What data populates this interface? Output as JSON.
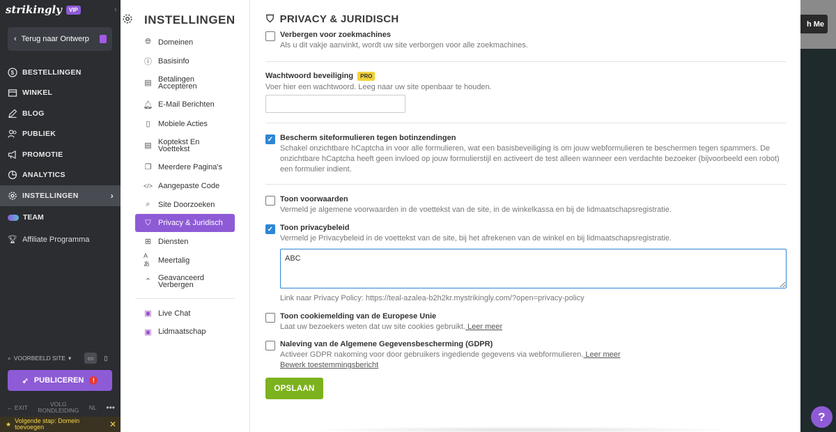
{
  "sidebar": {
    "brand": "strikingly",
    "vip": "VIP",
    "back_label": "Terug naar Ontwerp",
    "nav": [
      {
        "label": "BESTELLINGEN",
        "icon": "dollar-icon"
      },
      {
        "label": "WINKEL",
        "icon": "store-icon"
      },
      {
        "label": "BLOG",
        "icon": "pen-icon"
      },
      {
        "label": "PUBLIEK",
        "icon": "people-icon"
      },
      {
        "label": "PROMOTIE",
        "icon": "megaphone-icon"
      },
      {
        "label": "ANALYTICS",
        "icon": "pie-icon"
      },
      {
        "label": "INSTELLINGEN",
        "icon": "gear-icon"
      }
    ],
    "team": "TEAM",
    "affiliate": "Affiliate Programma",
    "preview": "VOORBEELD SITE",
    "publish": "PUBLICEREN",
    "exit": "EXIT",
    "tour": "VOLG RONDLEIDING",
    "lang": "NL",
    "next_step": "Volgende stap: Domein toevoegen"
  },
  "menu": {
    "title": "INSTELLINGEN",
    "items": [
      {
        "label": "Domeinen"
      },
      {
        "label": "Basisinfo"
      },
      {
        "label": "Betalingen Accepteren"
      },
      {
        "label": "E-Mail Berichten"
      },
      {
        "label": "Mobiele Acties"
      },
      {
        "label": "Koptekst En Voettekst"
      },
      {
        "label": "Meerdere Pagina's"
      },
      {
        "label": "Aangepaste Code"
      },
      {
        "label": "Site Doorzoeken"
      },
      {
        "label": "Privacy & Juridisch"
      },
      {
        "label": "Diensten"
      },
      {
        "label": "Meertalig"
      },
      {
        "label": "Geavanceerd Verbergen"
      },
      {
        "label": "Live Chat"
      },
      {
        "label": "Lidmaatschap"
      }
    ]
  },
  "main": {
    "title": "PRIVACY & JURIDISCH",
    "hide_search": {
      "label": "Verbergen voor zoekmachines",
      "desc": "Als u dit vakje aanvinkt, wordt uw site verborgen voor alle zoekmachines.",
      "checked": false
    },
    "password": {
      "label": "Wachtwoord beveiliging",
      "badge": "PRO",
      "desc": "Voer hier een wachtwoord. Leeg naar uw site openbaar te houden.",
      "value": ""
    },
    "bot": {
      "label": "Bescherm siteformulieren tegen botinzendingen",
      "desc": "Schakel onzichtbare hCaptcha in voor alle formulieren, wat een basisbeveiliging is om jouw webformulieren te beschermen tegen spammers. De onzichtbare hCaptcha heeft geen invloed op jouw formulierstijl en activeert de test alleen wanneer een verdachte bezoeker (bijvoorbeeld een robot) een formulier indient.",
      "checked": true
    },
    "terms": {
      "label": "Toon voorwaarden",
      "desc": "Vermeld je algemene voorwaarden in de voettekst van de site, in de winkelkassa en bij de lidmaatschapsregistratie.",
      "checked": false
    },
    "privacy": {
      "label": "Toon privacybeleid",
      "desc": "Vermeld je Privacybeleid in de voettekst van de site, bij het afrekenen van de winkel en bij lidmaatschapsregistratie.",
      "checked": true,
      "text": "ABC",
      "link": "Link naar Privacy Policy: https://teal-azalea-b2h2kr.mystrikingly.com/?open=privacy-policy"
    },
    "cookie": {
      "label": "Toon cookiemelding van de Europese Unie",
      "desc": "Laat uw bezoekers weten dat uw site cookies gebruikt.",
      "link": " Leer meer",
      "checked": false
    },
    "gdpr": {
      "label": "Naleving van de Algemene Gegevensbescherming (GDPR)",
      "desc": "Activeer GDPR nakoming voor door gebruikers ingediende gegevens via webformulieren.",
      "link": " Leer meer",
      "link2": "Bewerk toestemmingsbericht",
      "checked": false
    },
    "save": "OPSLAAN"
  },
  "backdrop": {
    "button": "h Me",
    "help": "?"
  }
}
